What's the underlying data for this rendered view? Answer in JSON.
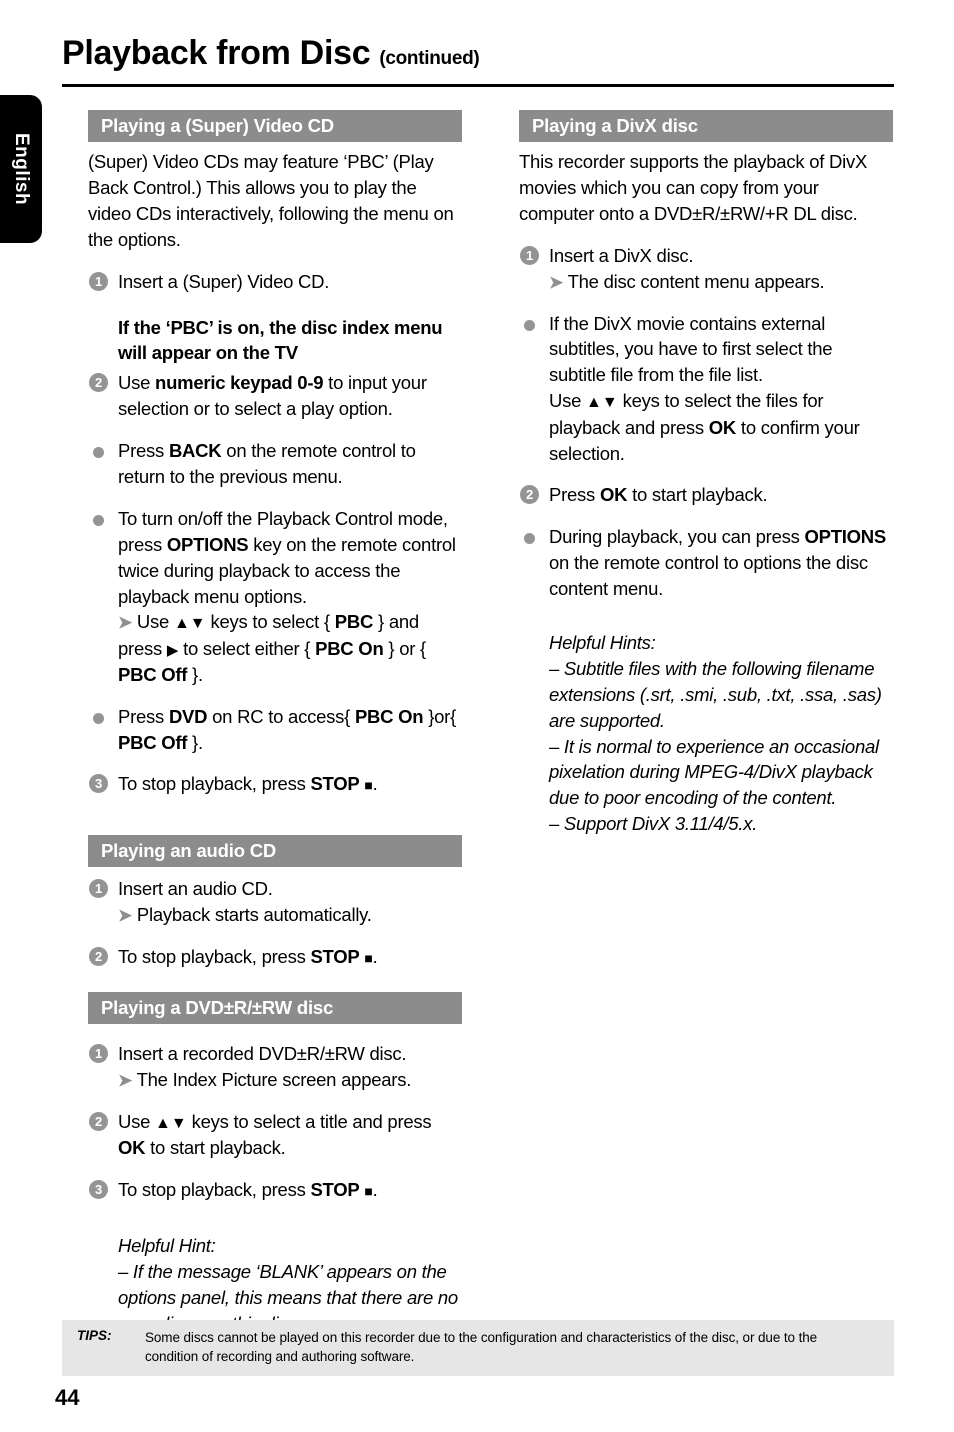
{
  "colors": {
    "section_bar": "#8c8c8c",
    "bullet_gray": "#949494",
    "tips_bg": "#e6e6e6",
    "tab_black": "#000000"
  },
  "language_tab": {
    "label": "English"
  },
  "header": {
    "title": "Playback from Disc",
    "continued": "(continued)"
  },
  "left_column": {
    "section1": {
      "bar": "Playing a (Super) Video CD",
      "intro": "(Super) Video CDs may feature ‘PBC’ (Play Back Control.) This allows you to play the video CDs interactively, following the menu on the options.",
      "step1_num": "1",
      "step1": "Insert a (Super) Video CD.",
      "pbc_heading": "If the ‘PBC’ is on, the disc index menu will appear on the TV",
      "step2_num": "2",
      "step2_a": "Use ",
      "step2_b": "numeric keypad 0-9",
      "step2_c": " to input your selection or to select a play option.",
      "bullet1_a": "Press ",
      "bullet1_b": "BACK",
      "bullet1_c": " on the remote control to return to the previous menu.",
      "bullet2_a": "To turn on/off the Playback Control mode, press ",
      "bullet2_b": "OPTIONS",
      "bullet2_c": " key on the remote control twice during playback to access the playback menu options.",
      "bullet2_sub_a": "Use ",
      "bullet2_sub_keys": "▲▼",
      "bullet2_sub_b": " keys to select { ",
      "bullet2_sub_pbc": "PBC",
      "bullet2_sub_c": " } and press ",
      "bullet2_sub_right": "▶",
      "bullet2_sub_d": " to select either { ",
      "bullet2_sub_pbcon": "PBC On",
      "bullet2_sub_e": " } or { ",
      "bullet2_sub_pbcoff": "PBC Off",
      "bullet2_sub_f": " }.",
      "bullet3_a": "Press ",
      "bullet3_b": "DVD",
      "bullet3_c": " on RC to access{ ",
      "bullet3_d": "PBC On",
      "bullet3_e": " }or{ ",
      "bullet3_f": "PBC Off",
      "bullet3_g": " }.",
      "step3_num": "3",
      "step3_a": "To stop playback, press ",
      "step3_b": "STOP",
      "step3_sq": "■",
      "step3_c": "."
    },
    "section2": {
      "bar": "Playing an audio CD",
      "step1_num": "1",
      "step1": "Insert an audio CD.",
      "step1_sub": "Playback starts automatically.",
      "step2_num": "2",
      "step2_a": "To stop playback, press ",
      "step2_b": "STOP",
      "step2_sq": "■",
      "step2_c": "."
    },
    "section3": {
      "bar": "Playing a DVD±R/±RW disc",
      "step1_num": "1",
      "step1": "Insert a recorded DVD±R/±RW disc.",
      "step1_sub": "The Index Picture screen appears.",
      "step2_num": "2",
      "step2_a": "Use ",
      "step2_keys": "▲▼",
      "step2_b": " keys to select a title and press ",
      "step2_ok": "OK",
      "step2_c": " to start playback.",
      "step3_num": "3",
      "step3_a": "To stop playback, press ",
      "step3_b": "STOP",
      "step3_sq": "■",
      "step3_c": ".",
      "hint_title": "Helpful Hint:",
      "hint_line": "– If the message ‘BLANK’ appears on the options panel, this means that there are no recordings on this disc."
    }
  },
  "right_column": {
    "section1": {
      "bar": "Playing a DivX disc",
      "intro": "This recorder supports the playback of DivX movies which you can copy from your computer onto a DVD±R/±RW/+R DL disc.",
      "step1_num": "1",
      "step1": "Insert a DivX disc.",
      "step1_sub": "The disc content menu appears.",
      "bullet1_a": "If the DivX movie contains external subtitles, you have to first select the subtitle file from the file list.",
      "bullet1_b": "Use ",
      "bullet1_keys": "▲▼",
      "bullet1_c": " keys to select the files for playback and press ",
      "bullet1_ok": "OK",
      "bullet1_d": " to confirm your selection.",
      "step2_num": "2",
      "step2_a": "Press ",
      "step2_ok": "OK",
      "step2_b": " to start playback.",
      "bullet2_a": "During playback, you can press ",
      "bullet2_b": "OPTIONS",
      "bullet2_c": " on the remote control to options the disc content menu.",
      "hint_title": "Helpful Hints:",
      "hint1": "– Subtitle files with the following filename extensions (.srt, .smi, .sub, .txt, .ssa, .sas) are supported.",
      "hint2": "– It is normal to experience an occasional pixelation during MPEG-4/DivX playback due to poor encoding of the content.",
      "hint3": "– Support DivX 3.11/4/5.x."
    }
  },
  "footer": {
    "tips_label": "TIPS:",
    "tips_text": "Some discs cannot be played on this recorder due to the configuration and characteristics of the disc, or due to the condition of recording and authoring software.",
    "page_number": "44"
  }
}
